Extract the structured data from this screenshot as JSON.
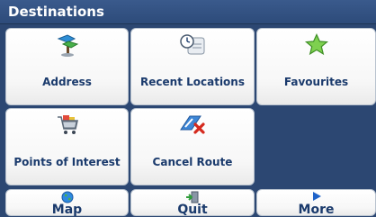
{
  "window": {
    "title": "Destinations"
  },
  "tiles": [
    {
      "label": "Address",
      "icon": "signpost-icon"
    },
    {
      "label": "Recent Locations",
      "icon": "clock-scroll-icon"
    },
    {
      "label": "Favourites",
      "icon": "star-icon"
    },
    {
      "label": "Points of Interest",
      "icon": "shopping-cart-icon"
    },
    {
      "label": "Cancel Route",
      "icon": "cancel-route-icon"
    }
  ],
  "bottom_bar": [
    {
      "label": "Map",
      "icon": "globe-icon"
    },
    {
      "label": "Quit",
      "icon": "exit-door-icon"
    },
    {
      "label": "More",
      "icon": "play-arrow-icon"
    }
  ],
  "colors": {
    "background": "#2c4772",
    "label_text": "#1a3a6c",
    "tile_fill": "#ffffff"
  }
}
